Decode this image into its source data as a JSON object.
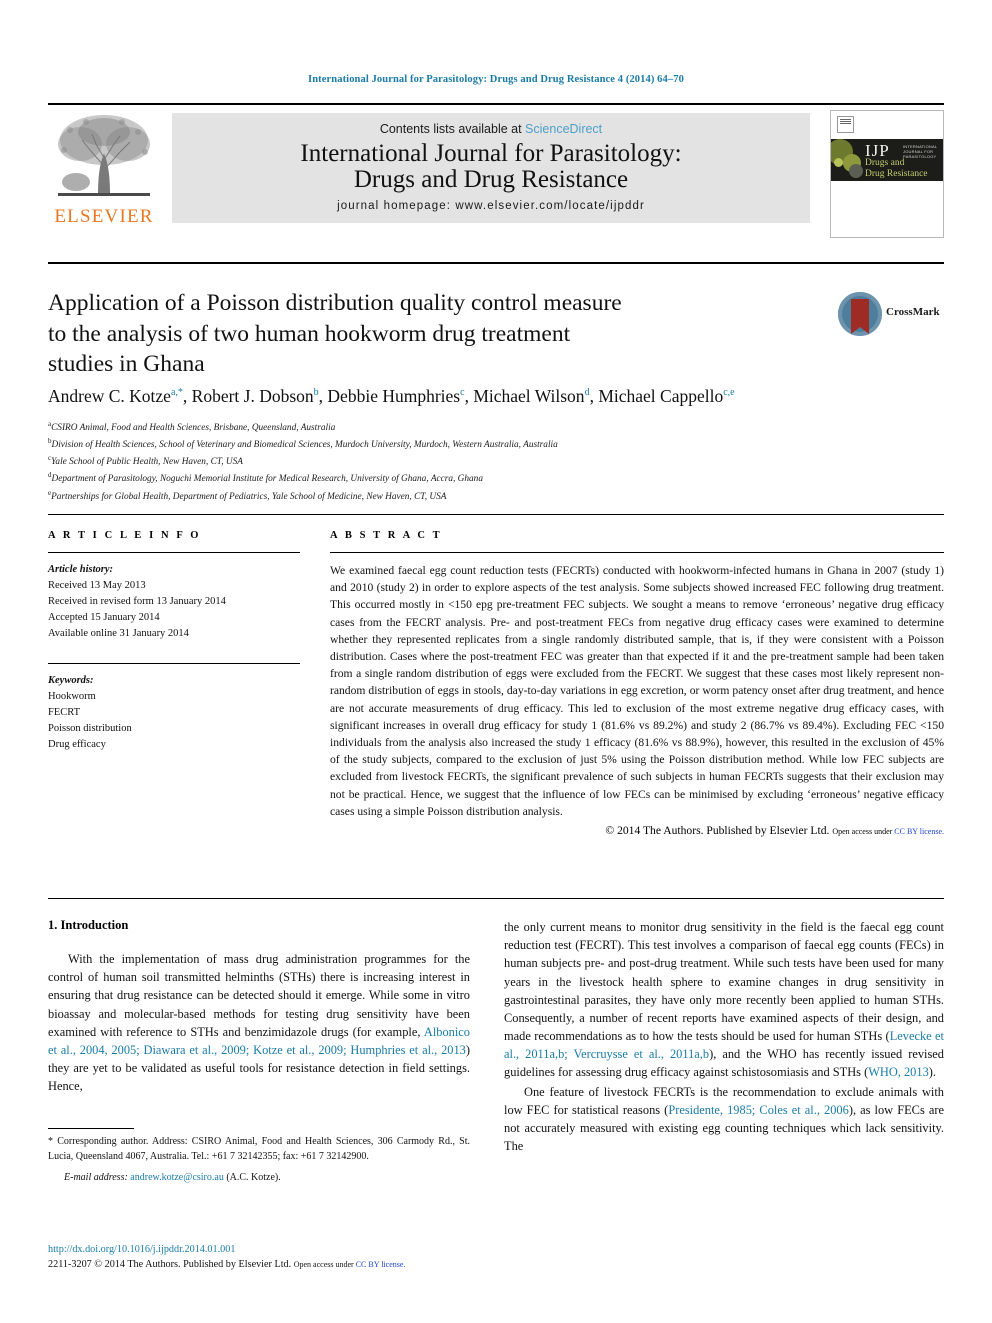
{
  "running_head": "International Journal for Parasitology: Drugs and Drug Resistance 4 (2014) 64–70",
  "masthead": {
    "contents_prefix": "Contents lists available at ",
    "sciencedirect": "ScienceDirect",
    "journal_title_line1": "International Journal for Parasitology:",
    "journal_title_line2": "Drugs and Drug Resistance",
    "homepage": "journal homepage: www.elsevier.com/locate/ijpddr",
    "publisher_word": "ELSEVIER",
    "cover": {
      "acronym": "IJP",
      "acronym_sub": "INTERNATIONAL JOURNAL FOR PARASITOLOGY",
      "sub_line1": "Drugs and",
      "sub_line2": "Drug Resistance"
    }
  },
  "article": {
    "title_line1": "Application of a Poisson distribution quality control measure",
    "title_line2": "to the analysis of two human hookworm drug treatment",
    "title_line3": "studies in Ghana",
    "crossmark_label": "CrossMark",
    "authors": [
      {
        "name": "Andrew C. Kotze",
        "marks": "a,*"
      },
      {
        "name": "Robert J. Dobson",
        "marks": "b"
      },
      {
        "name": "Debbie Humphries",
        "marks": "c"
      },
      {
        "name": "Michael Wilson",
        "marks": "d"
      },
      {
        "name": "Michael Cappello",
        "marks": "c,e"
      }
    ],
    "affiliations": [
      {
        "mark": "a",
        "text": "CSIRO Animal, Food and Health Sciences, Brisbane, Queensland, Australia"
      },
      {
        "mark": "b",
        "text": "Division of Health Sciences, School of Veterinary and Biomedical Sciences, Murdoch University, Murdoch, Western Australia, Australia"
      },
      {
        "mark": "c",
        "text": "Yale School of Public Health, New Haven, CT, USA"
      },
      {
        "mark": "d",
        "text": "Department of Parasitology, Noguchi Memorial Institute for Medical Research, University of Ghana, Accra, Ghana"
      },
      {
        "mark": "e",
        "text": "Partnerships for Global Health, Department of Pediatrics, Yale School of Medicine, New Haven, CT, USA"
      }
    ]
  },
  "article_info": {
    "heading": "A R T I C L E    I N F O",
    "history_label": "Article history:",
    "history": [
      "Received 13 May 2013",
      "Received in revised form 13 January 2014",
      "Accepted 15 January 2014",
      "Available online 31 January 2014"
    ],
    "keywords_label": "Keywords:",
    "keywords": [
      "Hookworm",
      "FECRT",
      "Poisson distribution",
      "Drug efficacy"
    ]
  },
  "abstract": {
    "heading": "A B S T R A C T",
    "text": "We examined faecal egg count reduction tests (FECRTs) conducted with hookworm-infected humans in Ghana in 2007 (study 1) and 2010 (study 2) in order to explore aspects of the test analysis. Some subjects showed increased FEC following drug treatment. This occurred mostly in <150 epg pre-treatment FEC subjects. We sought a means to remove ‘erroneous’ negative drug efficacy cases from the FECRT analysis. Pre- and post-treatment FECs from negative drug efficacy cases were examined to determine whether they represented replicates from a single randomly distributed sample, that is, if they were consistent with a Poisson distribution. Cases where the post-treatment FEC was greater than that expected if it and the pre-treatment sample had been taken from a single random distribution of eggs were excluded from the FECRT. We suggest that these cases most likely represent non-random distribution of eggs in stools, day-to-day variations in egg excretion, or worm patency onset after drug treatment, and hence are not accurate measurements of drug efficacy. This led to exclusion of the most extreme negative drug efficacy cases, with significant increases in overall drug efficacy for study 1 (81.6% vs 89.2%) and study 2 (86.7% vs 89.4%). Excluding FEC <150 individuals from the analysis also increased the study 1 efficacy (81.6% vs 88.9%), however, this resulted in the exclusion of 45% of the study subjects, compared to the exclusion of just 5% using the Poisson distribution method. While low FEC subjects are excluded from livestock FECRTs, the significant prevalence of such subjects in human FECRTs suggests that their exclusion may not be practical. Hence, we suggest that the influence of low FECs can be minimised by excluding ‘erroneous’ negative efficacy cases using a simple Poisson distribution analysis.",
    "copyright": "© 2014 The Authors. Published by Elsevier Ltd.",
    "open_access": "Open access under ",
    "license": "CC BY license."
  },
  "body": {
    "section_number_title": "1. Introduction",
    "left_paragraphs": [
      {
        "segments": [
          {
            "text": "With the implementation of mass drug administration programmes for the control of human soil transmitted helminths (STHs) there is increasing interest in ensuring that drug resistance can be detected should it emerge. While some in vitro bioassay and molecular-based methods for testing drug sensitivity have been examined with reference to STHs and benzimidazole drugs (for example, ",
            "link": false
          },
          {
            "text": "Albonico et al., 2004, 2005; Diawara et al., 2009; Kotze et al., 2009; Humphries et al., 2013",
            "link": true
          },
          {
            "text": ") they are yet to be validated as useful tools for resistance detection in field settings. Hence,",
            "link": false
          }
        ]
      }
    ],
    "right_paragraphs": [
      {
        "indent": false,
        "segments": [
          {
            "text": "the only current means to monitor drug sensitivity in the field is the faecal egg count reduction test (FECRT). This test involves a comparison of faecal egg counts (FECs) in human subjects pre- and post-drug treatment. While such tests have been used for many years in the livestock health sphere to examine changes in drug sensitivity in gastrointestinal parasites, they have only more recently been applied to human STHs. Consequently, a number of recent reports have examined aspects of their design, and made recommendations as to how the tests should be used for human STHs (",
            "link": false
          },
          {
            "text": "Levecke et al., 2011a,b; Vercruysse et al., 2011a,b",
            "link": true
          },
          {
            "text": "), and the WHO has recently issued revised guidelines for assessing drug efficacy against schistosomiasis and STHs (",
            "link": false
          },
          {
            "text": "WHO, 2013",
            "link": true
          },
          {
            "text": ").",
            "link": false
          }
        ]
      },
      {
        "indent": true,
        "segments": [
          {
            "text": "One feature of livestock FECRTs is the recommendation to exclude animals with low FEC for statistical reasons (",
            "link": false
          },
          {
            "text": "Presidente, 1985; Coles et al., 2006",
            "link": true
          },
          {
            "text": "), as low FECs are not accurately measured with existing egg counting techniques which lack sensitivity. The",
            "link": false
          }
        ]
      }
    ]
  },
  "footnote": {
    "text": "* Corresponding author. Address: CSIRO Animal, Food and Health Sciences, 306 Carmody Rd., St. Lucia, Queensland 4067, Australia. Tel.: +61 7 32142355; fax: +61 7 32142900.",
    "email_label": "E-mail address:",
    "email": "andrew.kotze@csiro.au",
    "email_suffix": " (A.C. Kotze)."
  },
  "footer": {
    "doi": "http://dx.doi.org/10.1016/j.ijpddr.2014.01.001",
    "issn_line": "2211-3207 © 2014 The Authors. Published by Elsevier Ltd.",
    "open_access": "Open access under ",
    "license": "CC BY license."
  },
  "colors": {
    "link_blue": "#1a7ba8",
    "license_blue": "#1a42d6",
    "elsevier_orange": "#e87722",
    "band_gray": "#e3e3e3"
  }
}
